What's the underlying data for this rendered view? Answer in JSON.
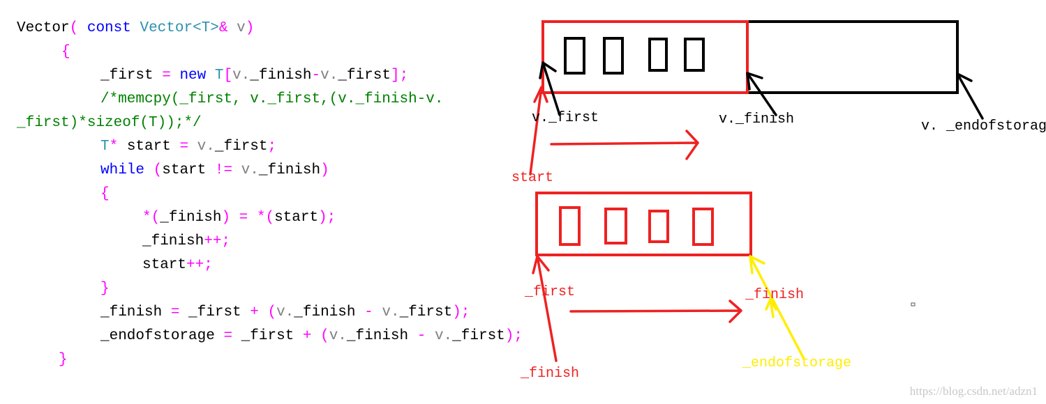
{
  "colors": {
    "plain": "#000000",
    "keyword": "#0000ff",
    "type": "#2b91af",
    "operator": "#ff00ff",
    "member": "#808080",
    "comment": "#008000",
    "red": "#ee2222",
    "yellow": "#ffee00",
    "black": "#000000"
  },
  "code_lines": [
    [
      [
        "Vector",
        "plain"
      ],
      [
        "( ",
        "operator"
      ],
      [
        "const ",
        "keyword"
      ],
      [
        "Vector<T>",
        "type"
      ],
      [
        "& ",
        "operator"
      ],
      [
        "v",
        "member"
      ],
      [
        ")",
        "operator"
      ]
    ],
    [
      [
        "{",
        "operator"
      ]
    ],
    [
      [
        "_first ",
        "plain"
      ],
      [
        "= ",
        "operator"
      ],
      [
        "new ",
        "keyword"
      ],
      [
        "T",
        "type"
      ],
      [
        "[",
        "operator"
      ],
      [
        "v.",
        "member"
      ],
      [
        "_finish",
        "plain"
      ],
      [
        "-",
        "operator"
      ],
      [
        "v.",
        "member"
      ],
      [
        "_first",
        "plain"
      ],
      [
        "];",
        "operator"
      ]
    ],
    [
      [
        "/*memcpy(_first, v._first,(v._finish-v.",
        "comment"
      ]
    ],
    [
      [
        "_first)*sizeof(T));*/",
        "comment"
      ]
    ],
    [
      [
        "T",
        "type"
      ],
      [
        "* ",
        "operator"
      ],
      [
        "start ",
        "plain"
      ],
      [
        "= ",
        "operator"
      ],
      [
        "v.",
        "member"
      ],
      [
        "_first",
        "plain"
      ],
      [
        ";",
        "operator"
      ]
    ],
    [
      [
        "while ",
        "keyword"
      ],
      [
        "(",
        "operator"
      ],
      [
        "start ",
        "plain"
      ],
      [
        "!= ",
        "operator"
      ],
      [
        "v.",
        "member"
      ],
      [
        "_finish",
        "plain"
      ],
      [
        ")",
        "operator"
      ]
    ],
    [
      [
        "{",
        "operator"
      ]
    ],
    [
      [
        "*(",
        "operator"
      ],
      [
        "_finish",
        "plain"
      ],
      [
        ") = *(",
        "operator"
      ],
      [
        "start",
        "plain"
      ],
      [
        ");",
        "operator"
      ]
    ],
    [
      [
        "_finish",
        "plain"
      ],
      [
        "++;",
        "operator"
      ]
    ],
    [
      [
        "start",
        "plain"
      ],
      [
        "++;",
        "operator"
      ]
    ],
    [
      [
        "}",
        "operator"
      ]
    ],
    [
      [
        "_finish ",
        "plain"
      ],
      [
        "= ",
        "operator"
      ],
      [
        "_first ",
        "plain"
      ],
      [
        "+ (",
        "operator"
      ],
      [
        "v.",
        "member"
      ],
      [
        "_finish ",
        "plain"
      ],
      [
        "- ",
        "operator"
      ],
      [
        "v.",
        "member"
      ],
      [
        "_first",
        "plain"
      ],
      [
        ");",
        "operator"
      ]
    ],
    [
      [
        "_endofstorage ",
        "plain"
      ],
      [
        "= ",
        "operator"
      ],
      [
        "_first ",
        "plain"
      ],
      [
        "+ (",
        "operator"
      ],
      [
        "v.",
        "member"
      ],
      [
        "_finish ",
        "plain"
      ],
      [
        "- ",
        "operator"
      ],
      [
        "v.",
        "member"
      ],
      [
        "_first",
        "plain"
      ],
      [
        ");",
        "operator"
      ]
    ],
    [
      [
        "}",
        "operator"
      ]
    ]
  ],
  "labels": {
    "v_first": "v._first",
    "v_finish": "v._finish",
    "v_endofstorage": "v. _endofstorage",
    "start": "start",
    "first": "_first",
    "finish_top": "_finish",
    "finish_bottom": "_finish",
    "endofstorage": "_endofstorage"
  },
  "watermark": "https://blog.csdn.net/adzn1"
}
